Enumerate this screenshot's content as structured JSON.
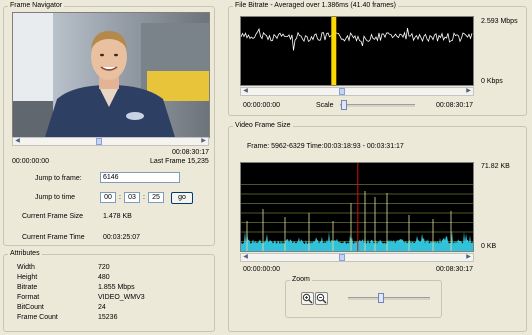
{
  "frame_navigator": {
    "title": "Frame Navigator",
    "current_time": "00:08:30:17",
    "start_time": "00:00:00:00",
    "last_frame_label": "Last Frame 15,235",
    "jump_to_frame_label": "Jump to frame:",
    "jump_to_frame_value": "6146",
    "jump_to_time_label": "Jump to time",
    "time_hh": "00",
    "time_mm": "03",
    "time_ss": "25",
    "time_sep": ":",
    "go_label": "go",
    "current_frame_size_label": "Current Frame Size",
    "current_frame_size_value": "1.478 KB",
    "current_frame_time_label": "Current Frame Time",
    "current_frame_time_value": "00:03:25:07"
  },
  "attributes": {
    "title": "Attributes",
    "rows": [
      {
        "label": "Width",
        "value": "720"
      },
      {
        "label": "Height",
        "value": "480"
      },
      {
        "label": "Bitrate",
        "value": "1.855 Mbps"
      },
      {
        "label": "Format",
        "value": "VIDEO_WMV3"
      },
      {
        "label": "BitCount",
        "value": "24"
      },
      {
        "label": "Frame Count",
        "value": "15236"
      }
    ]
  },
  "file_bitrate": {
    "title": "File Bitrate - Averaged over 1.386ms (41.40 frames)",
    "y_max_label": "2.593 Mbps",
    "y_min_label": "0 Kbps",
    "x_start": "00:00:00:00",
    "x_end": "00:08:30:17",
    "scale_label": "Scale",
    "marker_color": "#ffd800",
    "line_color": "#ffffff",
    "marker_position": 0.4
  },
  "video_frame_size": {
    "title": "Video Frame Size",
    "frame_info": "Frame: 5962-6329   Time:00:03:18:93 - 00:03:31:17",
    "y_max_label": "71.82 KB",
    "y_min_label": "0 KB",
    "x_start": "00:00:00:00",
    "x_end": "00:08:30:17",
    "zoom_label": "Zoom",
    "zoom_in_icon": "zoom-in-icon",
    "zoom_out_icon": "zoom-out-icon",
    "grid_color": "#8fb04a",
    "fill_color": "#36d6f0",
    "spike_color": "#e3e3a0",
    "marker_color": "#d01010",
    "marker_position": 0.4
  }
}
